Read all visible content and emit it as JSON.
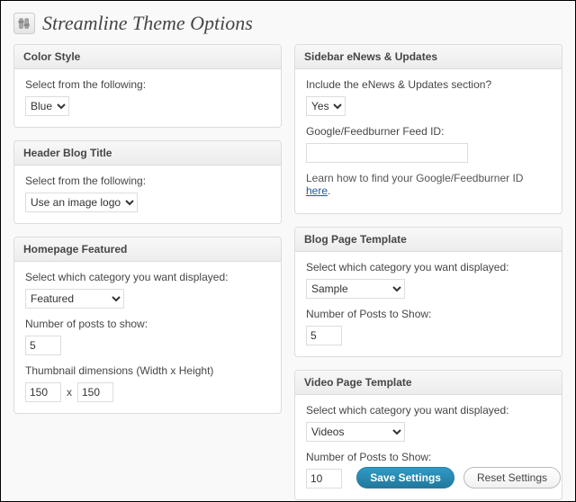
{
  "page": {
    "title": "Streamline Theme Options"
  },
  "color_style": {
    "heading": "Color Style",
    "label": "Select from the following:",
    "value": "Blue"
  },
  "header_blog_title": {
    "heading": "Header Blog Title",
    "label": "Select from the following:",
    "value": "Use an image logo"
  },
  "homepage_featured": {
    "heading": "Homepage Featured",
    "cat_label": "Select which category you want displayed:",
    "cat_value": "Featured",
    "posts_label": "Number of posts to show:",
    "posts_value": "5",
    "thumb_label": "Thumbnail dimensions (Width x Height)",
    "thumb_w": "150",
    "thumb_sep": "x",
    "thumb_h": "150"
  },
  "sidebar_enews": {
    "heading": "Sidebar eNews & Updates",
    "include_label": "Include the eNews & Updates section?",
    "include_value": "Yes",
    "feed_label": "Google/Feedburner Feed ID:",
    "feed_value": "",
    "help_prefix": "Learn how to find your Google/Feedburner ID ",
    "help_link": "here",
    "help_suffix": "."
  },
  "blog_template": {
    "heading": "Blog Page Template",
    "cat_label": "Select which category you want displayed:",
    "cat_value": "Sample",
    "posts_label": "Number of Posts to Show:",
    "posts_value": "5"
  },
  "video_template": {
    "heading": "Video Page Template",
    "cat_label": "Select which category you want displayed:",
    "cat_value": "Videos",
    "posts_label": "Number of Posts to Show:",
    "posts_value": "10"
  },
  "buttons": {
    "save": "Save Settings",
    "reset": "Reset Settings"
  }
}
